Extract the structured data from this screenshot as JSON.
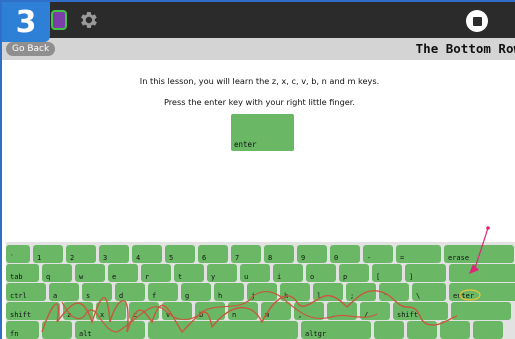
{
  "toolbar": {
    "step_badge": "3",
    "activity_icon": "activity-icon",
    "settings_icon": "gear-icon",
    "stop_icon": "stop-icon"
  },
  "titlebar": {
    "go_back_label": "Go Back",
    "title": "The Bottom Row"
  },
  "lesson": {
    "instruction": "In this lesson, you will learn the z, x, c, v, b, n and m keys.",
    "hint": "Press the enter key with your right little finger.",
    "prompt_key": "enter"
  },
  "keyboard": {
    "row1": [
      "`",
      "1",
      "2",
      "3",
      "4",
      "5",
      "6",
      "7",
      "8",
      "9",
      "0",
      "-",
      "=",
      "erase"
    ],
    "row2": [
      "tab",
      "q",
      "w",
      "e",
      "r",
      "t",
      "y",
      "u",
      "i",
      "o",
      "p",
      "[",
      "]",
      ""
    ],
    "row3": [
      "ctrl",
      "a",
      "s",
      "d",
      "f",
      "g",
      "h",
      "j",
      "k",
      "l",
      ";",
      "'",
      "\\",
      "enter"
    ],
    "row4": [
      "shift",
      "z",
      "x",
      "c",
      "v",
      "b",
      "n",
      "m",
      ",",
      ".",
      "/",
      "shift",
      ""
    ],
    "row5": [
      "fn",
      "",
      "alt",
      "",
      "altgr",
      "",
      "",
      "",
      ""
    ]
  },
  "colors": {
    "key": "#6ab866",
    "toolbar": "#2b2b2b",
    "badge": "#2e7fd6",
    "trace": "#c8583d",
    "pointer": "#e0247a"
  }
}
